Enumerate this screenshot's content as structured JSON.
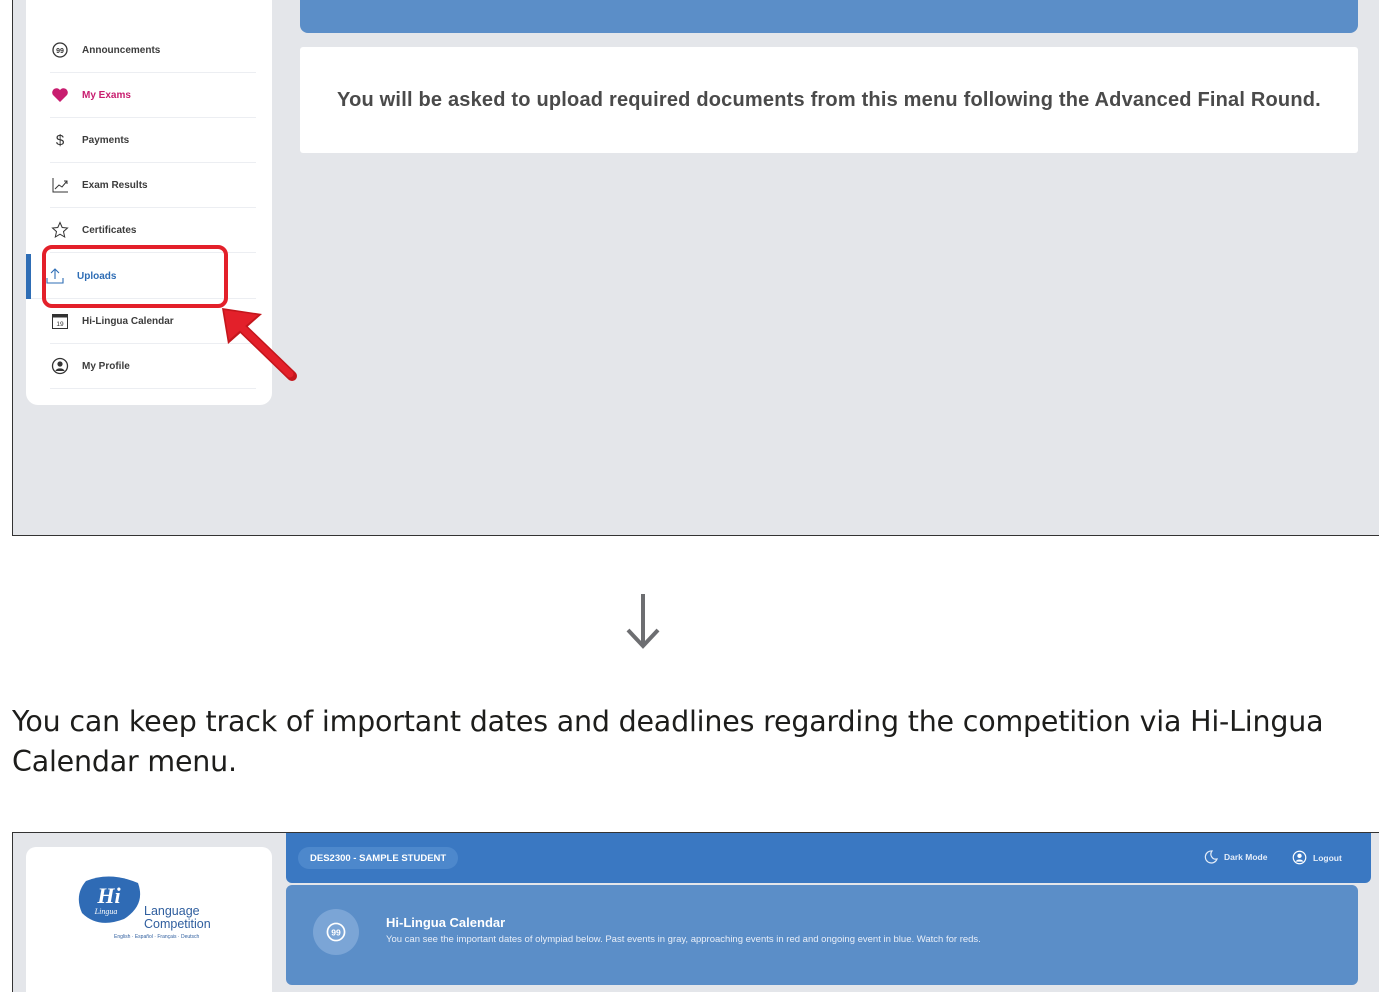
{
  "shot1": {
    "notice_text": "You will be asked to upload required documents from this menu following the Advanced Final Round.",
    "sidebar": {
      "items": [
        {
          "label": "Announcements",
          "icon": "speech-bubble-icon"
        },
        {
          "label": "My Exams",
          "icon": "heart-icon"
        },
        {
          "label": "Payments",
          "icon": "dollar-icon"
        },
        {
          "label": "Exam Results",
          "icon": "chart-line-icon"
        },
        {
          "label": "Certificates",
          "icon": "star-icon"
        },
        {
          "label": "Uploads",
          "icon": "upload-icon",
          "active": true
        },
        {
          "label": "Hi-Lingua Calendar",
          "icon": "calendar-icon",
          "calendar_day": "19"
        },
        {
          "label": "My Profile",
          "icon": "user-circle-icon"
        }
      ]
    },
    "colors": {
      "accent_blue": "#2e6db5",
      "pink": "#c81d6f",
      "highlight_red": "#e3202a"
    }
  },
  "caption": "You can keep track of important dates and deadlines regarding the competition via Hi-Lingua Calendar menu.",
  "shot2": {
    "logo": {
      "badge_text": "Hi",
      "badge_sub": "Lingua",
      "line1": "Language",
      "line2": "Competition",
      "languages": "English · Español · Français · Deutsch"
    },
    "topbar": {
      "student_id": "DES2300 - SAMPLE STUDENT",
      "dark_mode": "Dark Mode",
      "logout": "Logout"
    },
    "banner": {
      "title": "Hi-Lingua Calendar",
      "subtitle": "You can see the important dates of olympiad below. Past events in gray, approaching events in red and ongoing event in blue. Watch for reds."
    }
  }
}
